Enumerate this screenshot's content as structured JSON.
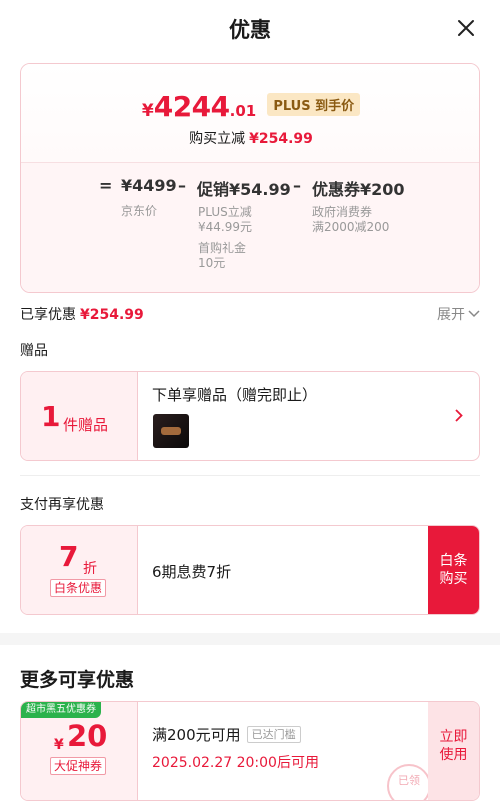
{
  "header": {
    "title": "优惠"
  },
  "price": {
    "yen": "¥",
    "integer": "4244",
    "decimal": ".01",
    "plus_badge": "PLUS 到手价",
    "reduce_label": "购买立减",
    "reduce_amount": "¥254.99"
  },
  "breakdown": {
    "eq": "=",
    "jd_price": "¥4499",
    "jd_price_label": "京东价",
    "minus1": "–",
    "promo": "促销¥54.99",
    "promo_detail_1": "PLUS立减",
    "promo_detail_2": "¥44.99元",
    "promo_detail_3": "首购礼金",
    "promo_detail_4": "10元",
    "minus2": "–",
    "coupon": "优惠券¥200",
    "coupon_detail_1": "政府消费券",
    "coupon_detail_2": "满2000减200"
  },
  "enjoyed": {
    "label": "已享优惠",
    "amount": "¥254.99",
    "expand": "展开"
  },
  "gift": {
    "section_label": "赠品",
    "count": "1",
    "unit": "件赠品",
    "title": "下单享赠品（赠完即止）"
  },
  "pay": {
    "section_label": "支付再享优惠",
    "discount": "7",
    "discount_unit": "折",
    "tag": "白条优惠",
    "text": "6期息费7折",
    "button_line1": "白条",
    "button_line2": "购买"
  },
  "more": {
    "title": "更多可享优惠",
    "coupon": {
      "green_tag": "超市黑五优惠券",
      "yen": "¥",
      "value": "20",
      "sub_tag": "大促神券",
      "condition": "满200元可用",
      "condition_tag": "已达门槛",
      "time": "2025.02.27 20:00后可用",
      "button_line1": "立即",
      "button_line2": "使用",
      "stamp": "已领"
    }
  }
}
